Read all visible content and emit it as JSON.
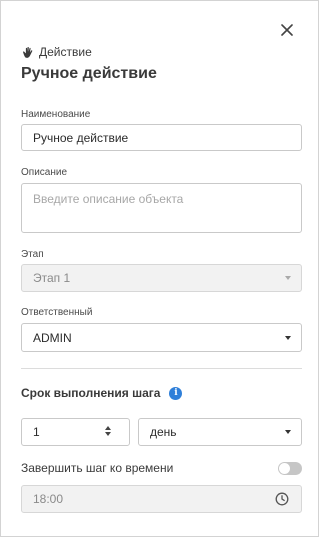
{
  "header": {
    "type_label": "Действие",
    "title": "Ручное действие",
    "close_icon": "close-icon",
    "type_icon": "hand-icon"
  },
  "fields": {
    "name": {
      "label": "Наименование",
      "value": "Ручное действие"
    },
    "description": {
      "label": "Описание",
      "placeholder": "Введите описание объекта",
      "value": ""
    },
    "stage": {
      "label": "Этап",
      "value": "Этап 1",
      "disabled": true
    },
    "responsible": {
      "label": "Ответственный",
      "value": "ADMIN"
    }
  },
  "deadline": {
    "title": "Срок выполнения шага",
    "info_icon": "info-icon",
    "amount": "1",
    "unit": "день",
    "by_time_label": "Завершить шаг ко времени",
    "by_time_enabled": false,
    "time_value": "18:00",
    "time_disabled": true
  },
  "colors": {
    "accent": "#2f7fd9",
    "toggle_off": "#c6c6c6",
    "disabled_bg": "#f2f2f2"
  }
}
